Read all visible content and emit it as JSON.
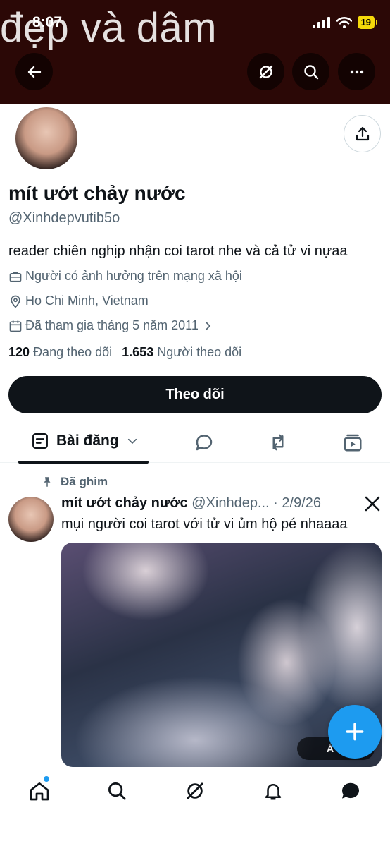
{
  "status": {
    "time": "8:07",
    "battery": "19"
  },
  "banner": {
    "text": "đẹp và dâm"
  },
  "header": {
    "back": "back-arrow-icon",
    "grok": "grok-icon",
    "search": "search-icon",
    "more": "more-icon"
  },
  "profile": {
    "name": "mít ướt chảy nước",
    "handle": "@Xinhdepvutib5o",
    "bio": "reader chiên nghịp nhận coi tarot nhe và cả tử vi nựaa",
    "category": "Người có ảnh hưởng trên mạng xã hội",
    "location": "Ho Chi Minh, Vietnam",
    "joined": "Đã tham gia tháng 5 năm 2011",
    "following_count": "120",
    "following_label": "Đang theo dõi",
    "followers_count": "1.653",
    "followers_label": "Người theo dõi"
  },
  "actions": {
    "follow_label": "Theo dõi"
  },
  "tabs": {
    "posts_label": "Bài đăng"
  },
  "pinned_post": {
    "pinned_label": "Đã ghim",
    "author_name": "mít ướt chảy nước",
    "author_handle": "@Xinhdep...",
    "date": "· 2/9/26",
    "text": "mụi người coi tarot với tử vi ủm hộ pé nhaaaa",
    "media_badge": "Á"
  },
  "colors": {
    "accent": "#1d9bf0",
    "banner": "#2b0806",
    "text": "#0f1419",
    "muted": "#536471"
  }
}
